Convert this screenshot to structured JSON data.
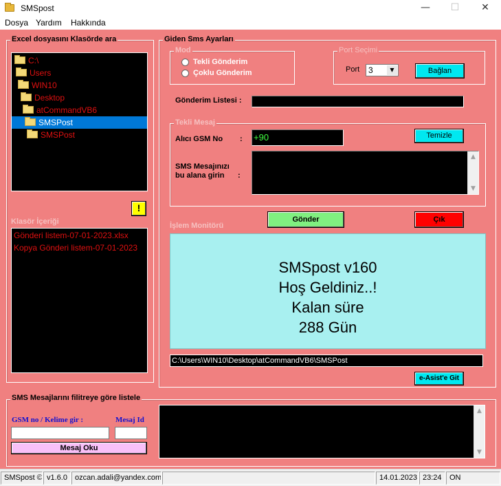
{
  "window": {
    "title": "SMSpost",
    "minimize": "—",
    "maximize": "☐",
    "close": "✕"
  },
  "menu": [
    "Dosya",
    "Yardım",
    "Hakkında"
  ],
  "explorer": {
    "title": "Excel dosyasını Klasörde ara",
    "tree": [
      "C:\\",
      "Users",
      "WIN10",
      "Desktop",
      "atCommandVB6",
      "SMSPost",
      "SMSPost"
    ],
    "selected_index": 5,
    "warning_button": "!",
    "content_label": "Klasör İçeriği",
    "files": [
      "Gönderi listem-07-01-2023.xlsx",
      "Kopya Gönderi listem-07-01-2023"
    ]
  },
  "settings": {
    "title": "Giden Sms Ayarları",
    "mode": {
      "title": "Mod",
      "options": [
        "Tekli Gönderim",
        "Çoklu Gönderim"
      ]
    },
    "port": {
      "title": "Port Seçimi",
      "label": "Port",
      "value": "3",
      "connect_button": "Bağlan"
    },
    "send_list": {
      "label": "Gönderim Listesi :",
      "value": ""
    },
    "single": {
      "title": "Tekli Mesaj",
      "recipient_label": "Alıcı GSM No",
      "recipient_colon": ":",
      "recipient_value": "+90",
      "clear_button": "Temizle",
      "message_label_1": "SMS Mesajınızı",
      "message_label_2": "bu alana girin",
      "message_colon": ":",
      "message_value": ""
    },
    "send_button": "Gönder",
    "exit_button": "Çık",
    "monitor": {
      "title": "İşlem Monitörü",
      "lines": [
        "SMSpost v160",
        "Hoş Geldiniz..!",
        "Kalan süre",
        "288 Gün"
      ]
    },
    "path": "C:\\Users\\WIN10\\Desktop\\atCommandVB6\\SMSPost",
    "easist_button": "e-Asist'e Git"
  },
  "filter": {
    "title": "SMS Mesajlarını filitreye göre listele",
    "gsm_label": "GSM no / Kelime gir :",
    "gsm_value": "",
    "id_label": "Mesaj Id",
    "id_value": "",
    "read_button": "Mesaj Oku",
    "output": ""
  },
  "status": {
    "app": "SMSpost ©",
    "version": "v1.6.0",
    "email": "ozcan.adali@yandex.com",
    "date": "14.01.2023",
    "time": "23:24",
    "state": "ON"
  },
  "colors": {
    "background": "#f08080",
    "tree_text": "#e01010",
    "selected": "#0078d7",
    "monitor": "#a8f0f0",
    "send_button": "#80f080",
    "exit_button": "#ff0000",
    "cyan_button": "#00e8f0",
    "read_button": "#f8c0f8",
    "warning": "#ffff00",
    "recipient_text": "#40ff40"
  }
}
